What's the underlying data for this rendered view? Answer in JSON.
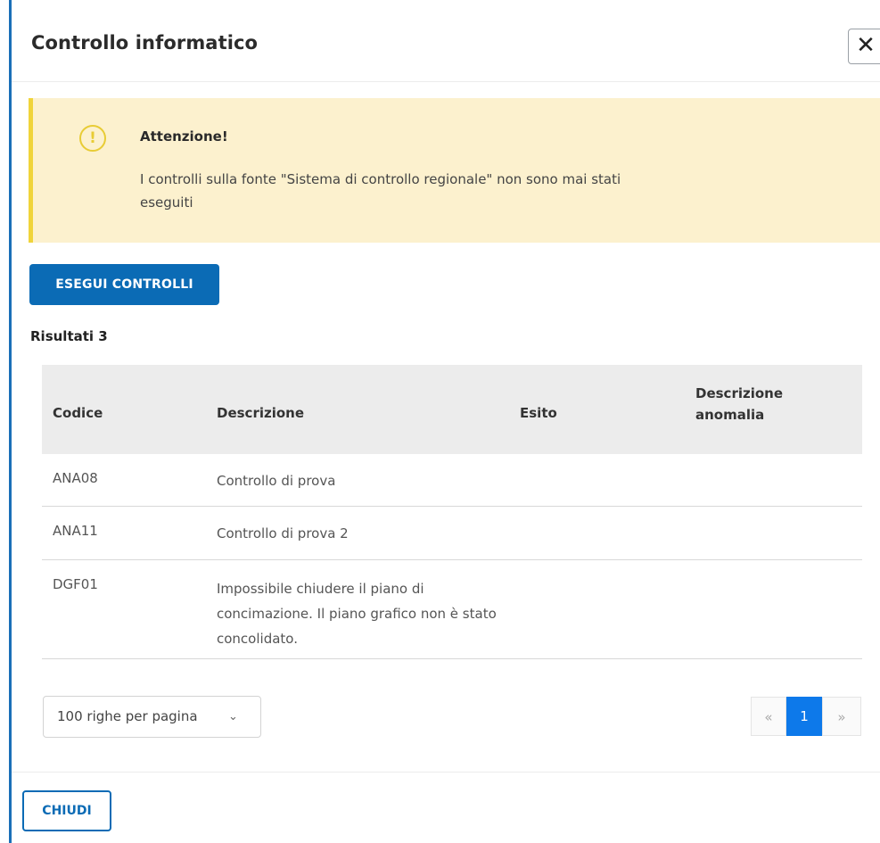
{
  "modal": {
    "title": "Controllo informatico",
    "close_symbol": "✕"
  },
  "alert": {
    "icon": "warning-icon",
    "icon_glyph": "!",
    "title": "Attenzione!",
    "text": "I controlli sulla fonte \"Sistema di controllo regionale\" non sono mai stati eseguiti",
    "background": "#fcf1ce",
    "accent": "#f0d43a"
  },
  "actions": {
    "run_label": "ESEGUI CONTROLLI",
    "close_label": "CHIUDI"
  },
  "results": {
    "label": "Risultati 3"
  },
  "table": {
    "headers": {
      "code": "Codice",
      "description": "Descrizione",
      "outcome": "Esito",
      "anomaly": "Descrizione anomalia"
    },
    "rows": [
      {
        "code": "ANA08",
        "description": "Controllo di prova",
        "outcome": "",
        "anomaly": ""
      },
      {
        "code": "ANA11",
        "description": "Controllo di prova 2",
        "outcome": "",
        "anomaly": ""
      },
      {
        "code": "DGF01",
        "description": "Impossibile chiudere il piano di concimazione. Il piano grafico non è stato concolidato.",
        "outcome": "",
        "anomaly": ""
      }
    ]
  },
  "pagination": {
    "rows_per_page": "100 righe per pagina",
    "prev": "«",
    "current": "1",
    "next": "»",
    "accent": "#0d79ea"
  },
  "colors": {
    "primary": "#0b6bb5",
    "left_edge": "#1a6fb8"
  }
}
